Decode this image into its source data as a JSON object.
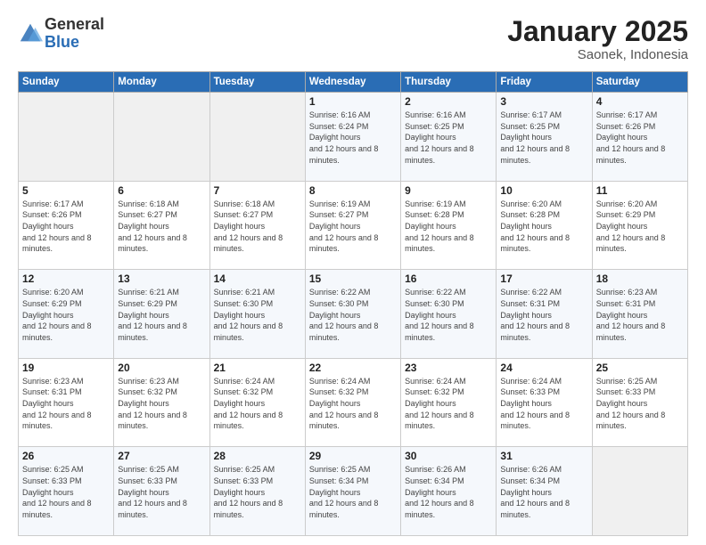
{
  "logo": {
    "general": "General",
    "blue": "Blue"
  },
  "title": "January 2025",
  "subtitle": "Saonek, Indonesia",
  "days_of_week": [
    "Sunday",
    "Monday",
    "Tuesday",
    "Wednesday",
    "Thursday",
    "Friday",
    "Saturday"
  ],
  "weeks": [
    [
      {
        "day": "",
        "empty": true
      },
      {
        "day": "",
        "empty": true
      },
      {
        "day": "",
        "empty": true
      },
      {
        "day": "1",
        "sunrise": "6:16 AM",
        "sunset": "6:24 PM",
        "daylight": "12 hours and 8 minutes."
      },
      {
        "day": "2",
        "sunrise": "6:16 AM",
        "sunset": "6:25 PM",
        "daylight": "12 hours and 8 minutes."
      },
      {
        "day": "3",
        "sunrise": "6:17 AM",
        "sunset": "6:25 PM",
        "daylight": "12 hours and 8 minutes."
      },
      {
        "day": "4",
        "sunrise": "6:17 AM",
        "sunset": "6:26 PM",
        "daylight": "12 hours and 8 minutes."
      }
    ],
    [
      {
        "day": "5",
        "sunrise": "6:17 AM",
        "sunset": "6:26 PM",
        "daylight": "12 hours and 8 minutes."
      },
      {
        "day": "6",
        "sunrise": "6:18 AM",
        "sunset": "6:27 PM",
        "daylight": "12 hours and 8 minutes."
      },
      {
        "day": "7",
        "sunrise": "6:18 AM",
        "sunset": "6:27 PM",
        "daylight": "12 hours and 8 minutes."
      },
      {
        "day": "8",
        "sunrise": "6:19 AM",
        "sunset": "6:27 PM",
        "daylight": "12 hours and 8 minutes."
      },
      {
        "day": "9",
        "sunrise": "6:19 AM",
        "sunset": "6:28 PM",
        "daylight": "12 hours and 8 minutes."
      },
      {
        "day": "10",
        "sunrise": "6:20 AM",
        "sunset": "6:28 PM",
        "daylight": "12 hours and 8 minutes."
      },
      {
        "day": "11",
        "sunrise": "6:20 AM",
        "sunset": "6:29 PM",
        "daylight": "12 hours and 8 minutes."
      }
    ],
    [
      {
        "day": "12",
        "sunrise": "6:20 AM",
        "sunset": "6:29 PM",
        "daylight": "12 hours and 8 minutes."
      },
      {
        "day": "13",
        "sunrise": "6:21 AM",
        "sunset": "6:29 PM",
        "daylight": "12 hours and 8 minutes."
      },
      {
        "day": "14",
        "sunrise": "6:21 AM",
        "sunset": "6:30 PM",
        "daylight": "12 hours and 8 minutes."
      },
      {
        "day": "15",
        "sunrise": "6:22 AM",
        "sunset": "6:30 PM",
        "daylight": "12 hours and 8 minutes."
      },
      {
        "day": "16",
        "sunrise": "6:22 AM",
        "sunset": "6:30 PM",
        "daylight": "12 hours and 8 minutes."
      },
      {
        "day": "17",
        "sunrise": "6:22 AM",
        "sunset": "6:31 PM",
        "daylight": "12 hours and 8 minutes."
      },
      {
        "day": "18",
        "sunrise": "6:23 AM",
        "sunset": "6:31 PM",
        "daylight": "12 hours and 8 minutes."
      }
    ],
    [
      {
        "day": "19",
        "sunrise": "6:23 AM",
        "sunset": "6:31 PM",
        "daylight": "12 hours and 8 minutes."
      },
      {
        "day": "20",
        "sunrise": "6:23 AM",
        "sunset": "6:32 PM",
        "daylight": "12 hours and 8 minutes."
      },
      {
        "day": "21",
        "sunrise": "6:24 AM",
        "sunset": "6:32 PM",
        "daylight": "12 hours and 8 minutes."
      },
      {
        "day": "22",
        "sunrise": "6:24 AM",
        "sunset": "6:32 PM",
        "daylight": "12 hours and 8 minutes."
      },
      {
        "day": "23",
        "sunrise": "6:24 AM",
        "sunset": "6:32 PM",
        "daylight": "12 hours and 8 minutes."
      },
      {
        "day": "24",
        "sunrise": "6:24 AM",
        "sunset": "6:33 PM",
        "daylight": "12 hours and 8 minutes."
      },
      {
        "day": "25",
        "sunrise": "6:25 AM",
        "sunset": "6:33 PM",
        "daylight": "12 hours and 8 minutes."
      }
    ],
    [
      {
        "day": "26",
        "sunrise": "6:25 AM",
        "sunset": "6:33 PM",
        "daylight": "12 hours and 8 minutes."
      },
      {
        "day": "27",
        "sunrise": "6:25 AM",
        "sunset": "6:33 PM",
        "daylight": "12 hours and 8 minutes."
      },
      {
        "day": "28",
        "sunrise": "6:25 AM",
        "sunset": "6:33 PM",
        "daylight": "12 hours and 8 minutes."
      },
      {
        "day": "29",
        "sunrise": "6:25 AM",
        "sunset": "6:34 PM",
        "daylight": "12 hours and 8 minutes."
      },
      {
        "day": "30",
        "sunrise": "6:26 AM",
        "sunset": "6:34 PM",
        "daylight": "12 hours and 8 minutes."
      },
      {
        "day": "31",
        "sunrise": "6:26 AM",
        "sunset": "6:34 PM",
        "daylight": "12 hours and 8 minutes."
      },
      {
        "day": "",
        "empty": true
      }
    ]
  ]
}
